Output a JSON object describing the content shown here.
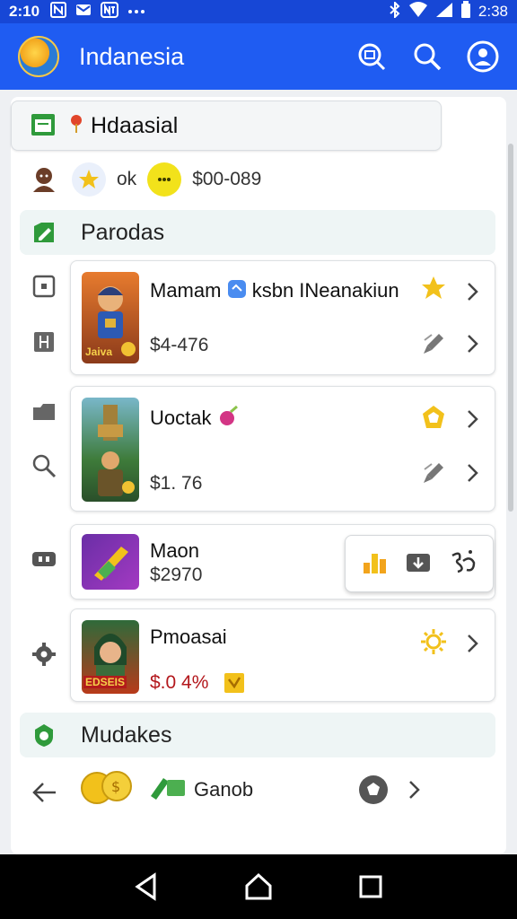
{
  "status_bar": {
    "time": "2:10",
    "clock_right": "2:38",
    "icons": [
      "n-icon",
      "mail-icon",
      "nt-icon",
      "more-dots"
    ]
  },
  "app_bar": {
    "title": "Indanesia"
  },
  "location": {
    "label": "Hdaasial"
  },
  "user_row": {
    "name": "ok",
    "balance": "$00-089"
  },
  "sections": {
    "first": "Parodas",
    "second": "Mudakes"
  },
  "items": [
    {
      "title": "Mamam",
      "title_extra": "ksbn INeanakiun",
      "price": "$4-476",
      "thumb_text": "Jaiva"
    },
    {
      "title": "Uoctak",
      "price": "$1. 76"
    },
    {
      "title": "Maon",
      "price": "$2970"
    },
    {
      "title": "Pmoasai",
      "price": "$.0 4%",
      "thumb_text": "EDSEIS"
    }
  ],
  "bottom_row": {
    "label": "Ganob"
  },
  "colors": {
    "appbar": "#1f5cf2",
    "statusbar": "#1747d6",
    "star": "#f2c11b",
    "accent_green": "#2f9a3b",
    "price_red": "#b3171c"
  }
}
